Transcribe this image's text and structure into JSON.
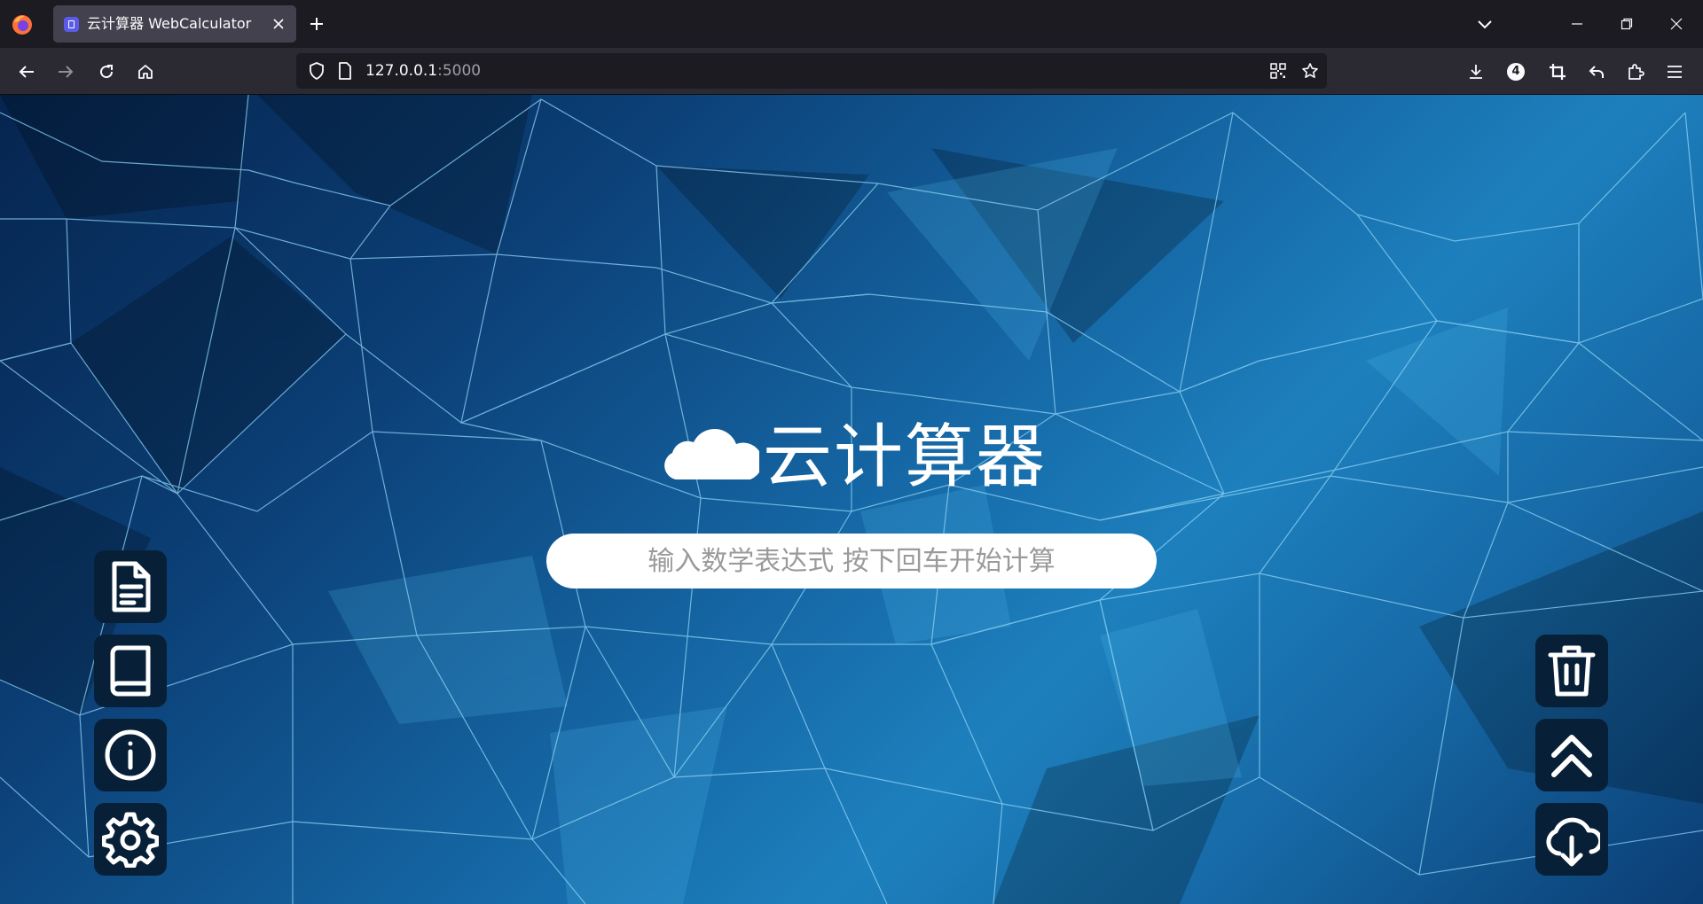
{
  "browser": {
    "tab": {
      "title": "云计算器 WebCalculator"
    },
    "url": {
      "host": "127.0.0.1",
      "port": ":5000"
    },
    "extension_badge": "4"
  },
  "page": {
    "title": "云计算器",
    "input": {
      "placeholder": "输入数学表达式 按下回车开始计算",
      "value": ""
    },
    "left_buttons": [
      {
        "icon": "document-icon"
      },
      {
        "icon": "book-icon"
      },
      {
        "icon": "info-icon"
      },
      {
        "icon": "gear-icon"
      }
    ],
    "right_buttons": [
      {
        "icon": "trash-icon"
      },
      {
        "icon": "double-chevron-up-icon"
      },
      {
        "icon": "cloud-download-icon"
      }
    ]
  }
}
